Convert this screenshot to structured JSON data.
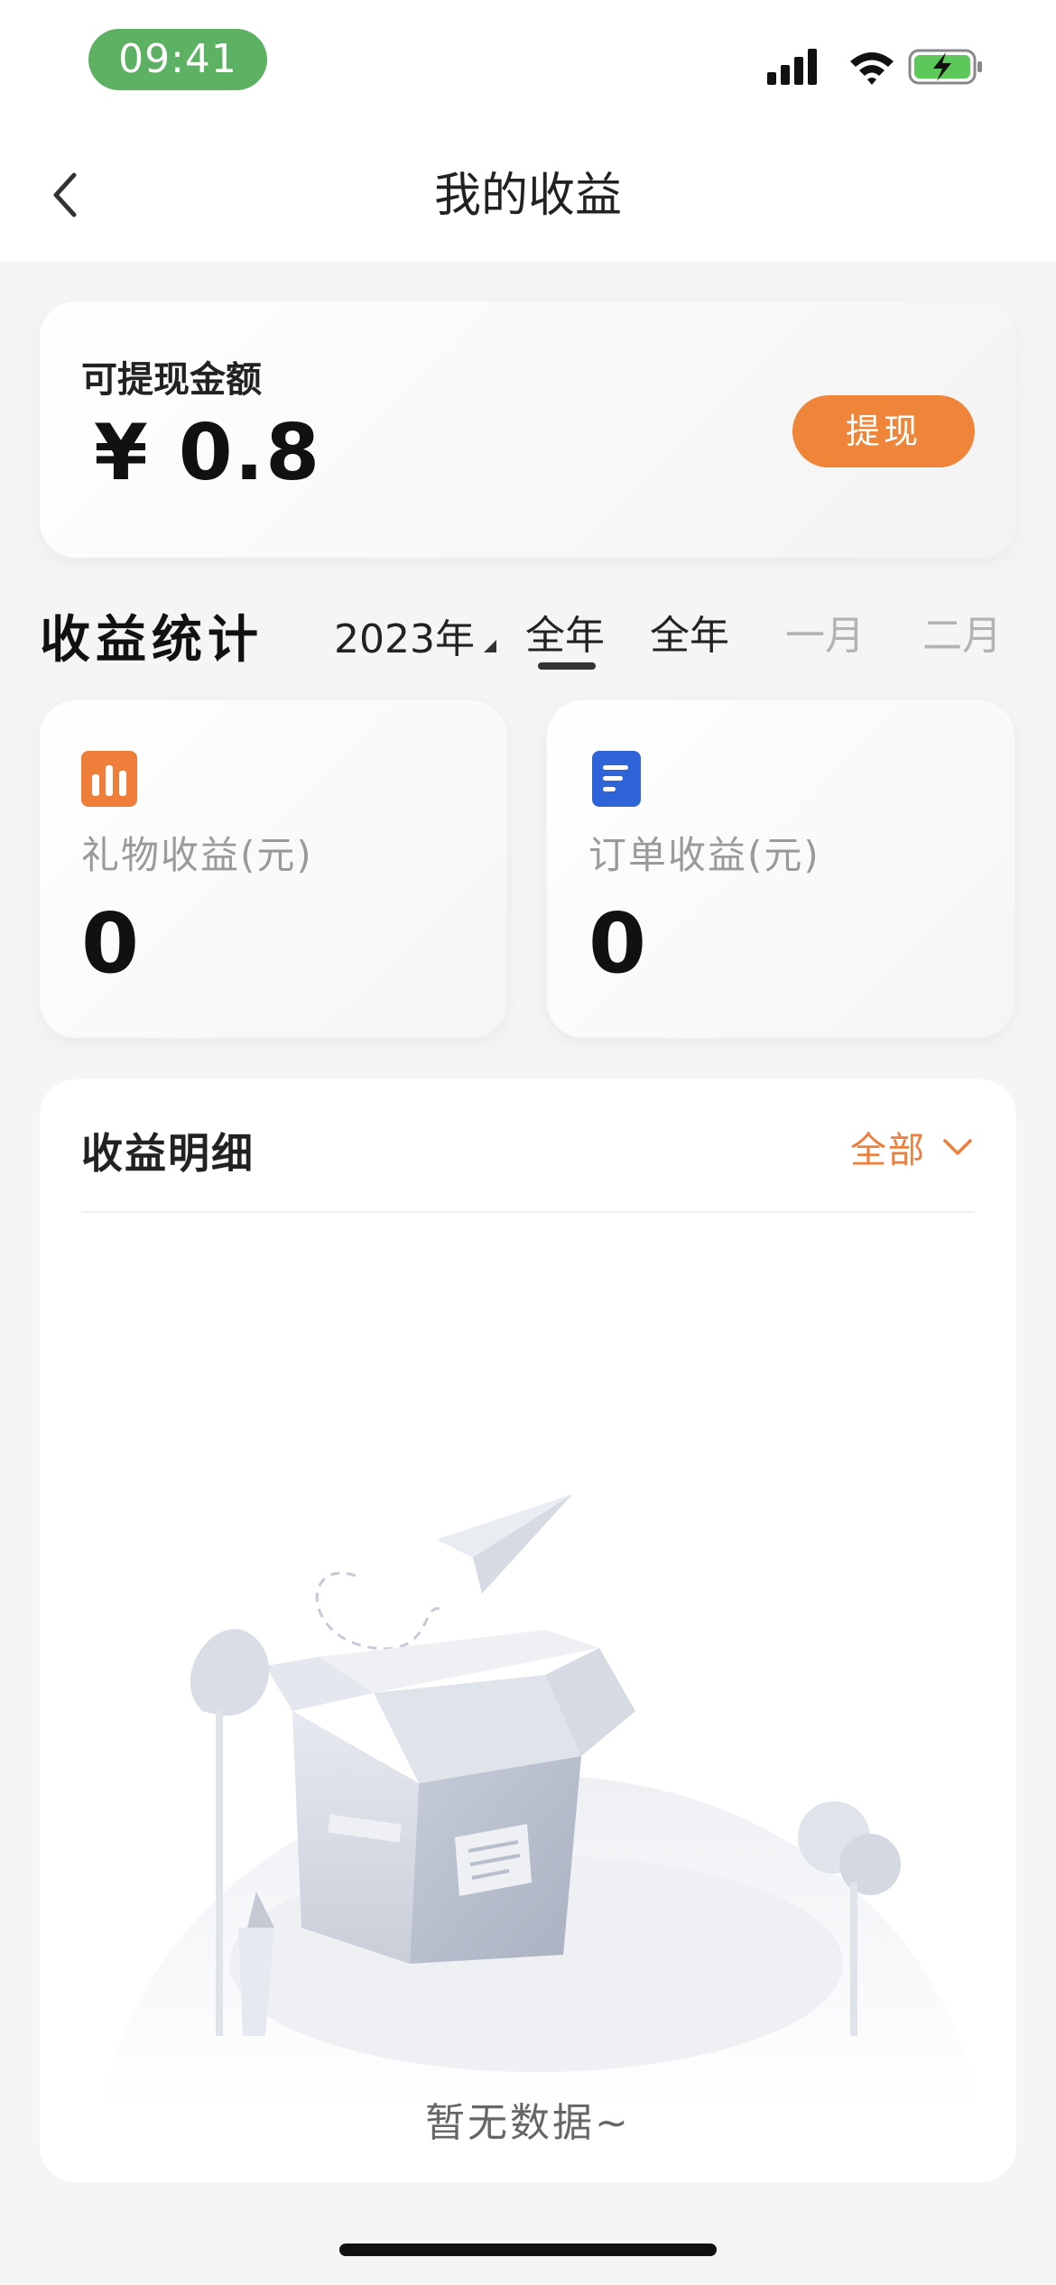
{
  "status_bar": {
    "time": "09:41"
  },
  "nav": {
    "title": "我的收益"
  },
  "balance": {
    "label": "可提现金额",
    "amount": "¥ 0.8",
    "withdraw_label": "提现"
  },
  "stats": {
    "title": "收益统计",
    "year": "2023年",
    "tabs": [
      "全年",
      "全年",
      "一月",
      "二月"
    ],
    "cards": [
      {
        "label": "礼物收益(元)",
        "value": "0",
        "icon": "bar-chart-icon",
        "icon_color": "#ee7e3a"
      },
      {
        "label": "订单收益(元)",
        "value": "0",
        "icon": "document-icon",
        "icon_color": "#2f64d8"
      }
    ]
  },
  "detail": {
    "title": "收益明细",
    "filter_label": "全部",
    "empty_text": "暂无数据~"
  },
  "colors": {
    "accent_orange": "#ee8538",
    "status_green": "#5cb262",
    "blue": "#2f64d8"
  }
}
